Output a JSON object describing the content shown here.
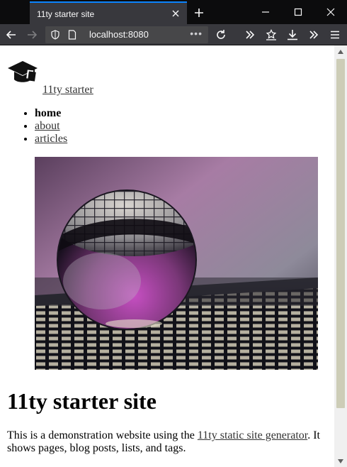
{
  "browser": {
    "tab_title": "11ty starter site",
    "url": "localhost:8080",
    "url_overflow": "•••",
    "colors": {
      "chrome_dark": "#0c0c0d",
      "toolbar": "#38383d",
      "urlbar": "#474749",
      "tab_accent": "#0a84ff",
      "icon": "#f9f9fa"
    }
  },
  "site": {
    "logo_icon": "graduation-cap-icon",
    "title_link": "11ty starter"
  },
  "nav": {
    "items": [
      {
        "label": "home",
        "current": true
      },
      {
        "label": "about",
        "current": false
      },
      {
        "label": "articles",
        "current": false
      }
    ]
  },
  "hero": {
    "alt": "glass sphere on a grid"
  },
  "main": {
    "heading": "11ty starter site",
    "intro_before": "This is a demonstration website using the ",
    "intro_link": "11ty static site generator",
    "intro_after": ". It shows pages, blog posts, lists, and tags."
  },
  "colors": {
    "link": "#333333",
    "text": "#000000",
    "scroll_thumb": "#cdcdb7"
  }
}
